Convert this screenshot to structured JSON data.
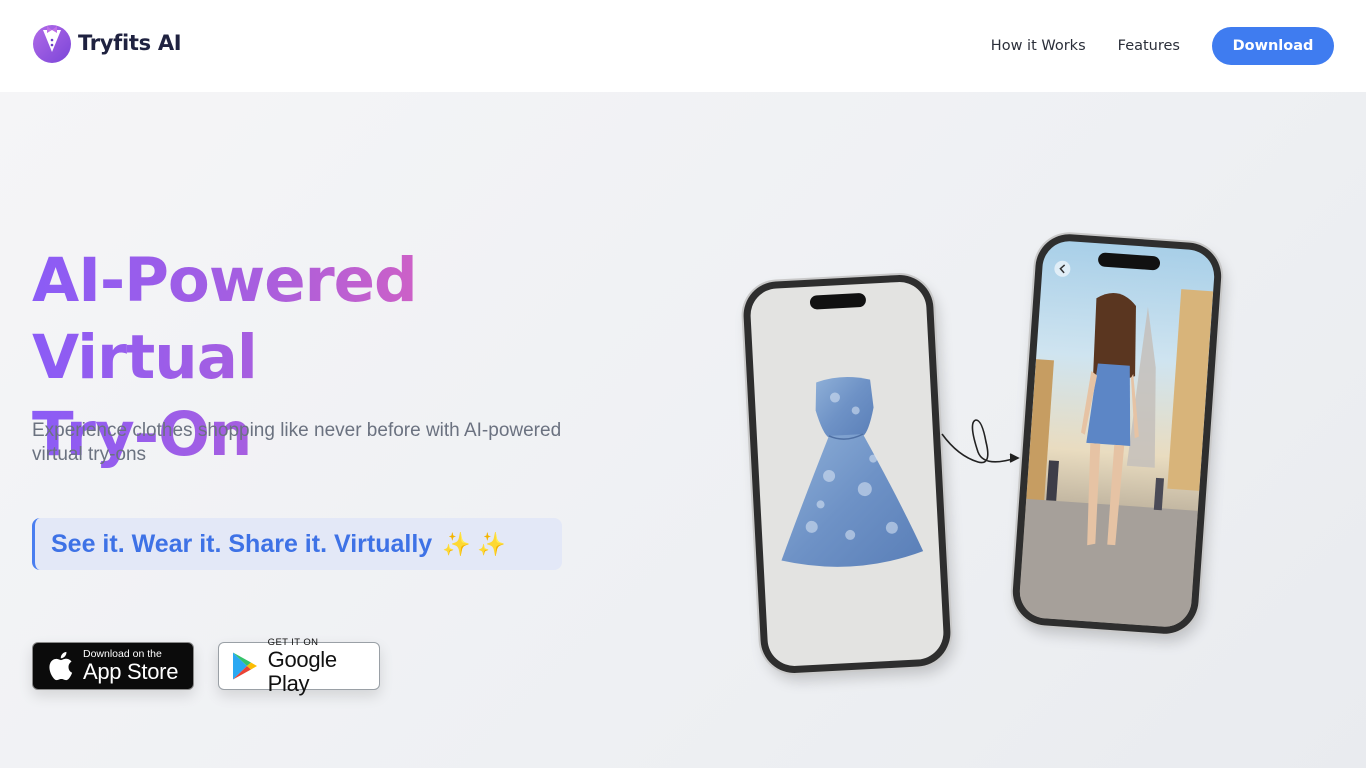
{
  "header": {
    "brand": "Tryfits AI",
    "nav": [
      {
        "label": "How it Works"
      },
      {
        "label": "Features"
      }
    ],
    "download_label": "Download"
  },
  "hero": {
    "headline_line1": "AI-Powered Virtual",
    "headline_line2": "Try-On",
    "subtitle": "Experience clothes shopping like never before with AI-powered virtual try-ons",
    "tagline": "See it. Wear it. Share it. Virtually",
    "tagline_emoji": "✨ ✨",
    "app_store": {
      "small": "Download on the",
      "big": "App Store"
    },
    "google_play": {
      "small": "GET IT ON",
      "big": "Google Play"
    }
  },
  "colors": {
    "accent_blue": "#3f7cf0",
    "gradient_start": "#8b5cf6",
    "gradient_end": "#e372bc"
  },
  "icons": [
    "tuxedo-logo-icon",
    "apple-icon",
    "google-play-icon",
    "back-arrow-icon",
    "curly-arrow-icon"
  ]
}
